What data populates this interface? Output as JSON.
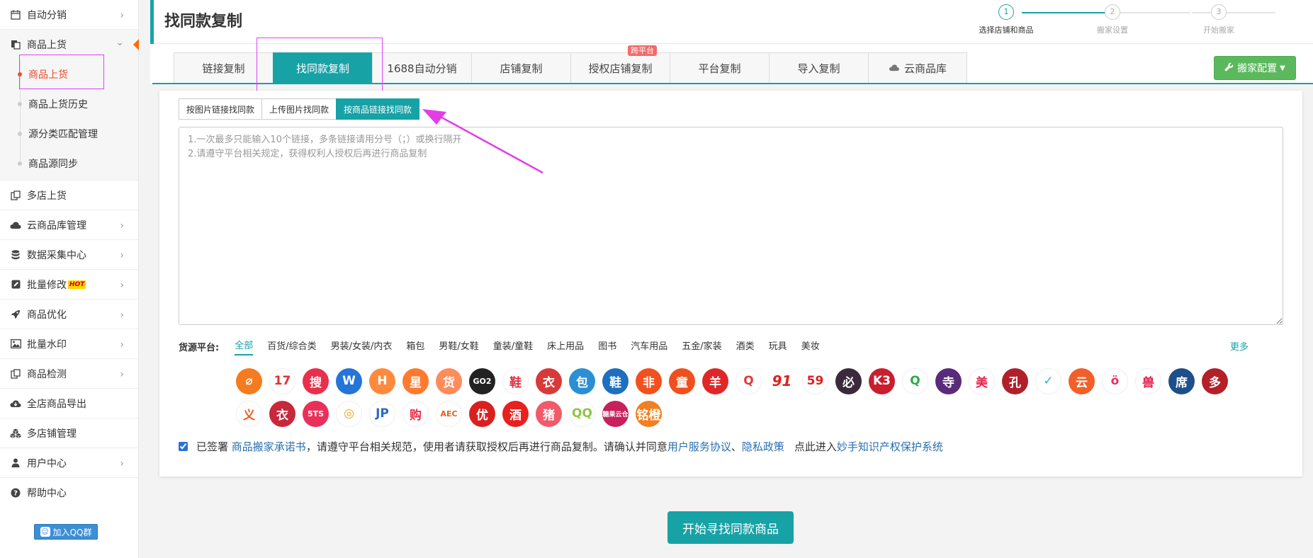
{
  "sidebar": {
    "items": [
      {
        "label": "自动分销",
        "icon": "calendar-icon",
        "chevron": "›"
      },
      {
        "label": "商品上货",
        "icon": "copy-icon",
        "chevron": "⌄"
      },
      {
        "label": "多店上货",
        "icon": "copy-multi-icon"
      },
      {
        "label": "云商品库管理",
        "icon": "cloud-icon",
        "chevron": "›"
      },
      {
        "label": "数据采集中心",
        "icon": "database-icon",
        "chevron": "›"
      },
      {
        "label": "批量修改",
        "icon": "edit-icon",
        "chevron": "›",
        "badge": "HOT"
      },
      {
        "label": "商品优化",
        "icon": "rocket-icon",
        "chevron": "›"
      },
      {
        "label": "批量水印",
        "icon": "image-icon",
        "chevron": "›"
      },
      {
        "label": "商品检测",
        "icon": "copy-check-icon",
        "chevron": "›"
      },
      {
        "label": "全店商品导出",
        "icon": "cloud-download-icon"
      },
      {
        "label": "多店铺管理",
        "icon": "cubes-icon"
      },
      {
        "label": "用户中心",
        "icon": "user-icon",
        "chevron": "›"
      },
      {
        "label": "帮助中心",
        "icon": "question-icon"
      }
    ],
    "sub_items": [
      "商品上货",
      "商品上货历史",
      "源分类匹配管理",
      "商品源同步"
    ],
    "qq_button": "加入QQ群"
  },
  "header": {
    "title": "找同款复制",
    "steps": [
      {
        "num": "1",
        "label": "选择店铺和商品"
      },
      {
        "num": "2",
        "label": "搬家设置"
      },
      {
        "num": "3",
        "label": "开始搬家"
      }
    ]
  },
  "tabs": [
    {
      "label": "链接复制"
    },
    {
      "label": "找同款复制"
    },
    {
      "label": "1688自动分销"
    },
    {
      "label": "店铺复制"
    },
    {
      "label": "授权店铺复制",
      "badge": "跨平台"
    },
    {
      "label": "平台复制"
    },
    {
      "label": "导入复制"
    },
    {
      "label": "云商品库"
    }
  ],
  "config_button": "搬家配置",
  "subtabs": [
    "按图片链接找同款",
    "上传图片找同款",
    "按商品链接找同款"
  ],
  "textarea": {
    "placeholder": "1.一次最多只能输入10个链接，多条链接请用分号（；）或换行隔开\n2.请遵守平台相关规定，获得权利人授权后再进行商品复制"
  },
  "platforms": {
    "label": "货源平台:",
    "categories": [
      "全部",
      "百货/综合类",
      "男装/女装/内衣",
      "箱包",
      "男鞋/女鞋",
      "童装/童鞋",
      "床上用品",
      "图书",
      "汽车用品",
      "五金/家装",
      "酒类",
      "玩具",
      "美妆"
    ],
    "more": "更多",
    "logos_row1": [
      {
        "text": "⌀",
        "color": "#f47b20"
      },
      {
        "text": "17",
        "color": "#ffffff",
        "fg": "#e03030"
      },
      {
        "text": "搜",
        "color": "#e8304c"
      },
      {
        "text": "W",
        "color": "#2574d8"
      },
      {
        "text": "H",
        "color": "#ff8a3d"
      },
      {
        "text": "星",
        "color": "#ff7a2f"
      },
      {
        "text": "货",
        "color": "#ff8c5a"
      },
      {
        "text": "GO2",
        "color": "#222222"
      },
      {
        "text": "鞋",
        "color": "#ffffff",
        "fg": "#e03040"
      },
      {
        "text": "衣",
        "color": "#d83a3a"
      },
      {
        "text": "包",
        "color": "#2b8fd4"
      },
      {
        "text": "鞋",
        "color": "#1e6fc0"
      },
      {
        "text": "非",
        "color": "#f2501e"
      },
      {
        "text": "童",
        "color": "#f0501e"
      },
      {
        "text": "羊",
        "color": "#e02626"
      },
      {
        "text": "Q",
        "color": "#ffffff",
        "fg": "#e03b3b"
      },
      {
        "text": "91",
        "color": "plain"
      },
      {
        "text": "59",
        "color": "#ffffff",
        "fg": "#e02020"
      },
      {
        "text": "必",
        "color": "#3a2a3a"
      },
      {
        "text": "K3",
        "color": "#c81e2e"
      },
      {
        "text": "Q",
        "color": "#ffffff",
        "fg": "#2fa84a"
      },
      {
        "text": "寺",
        "color": "#5a2b7a"
      },
      {
        "text": "美",
        "color": "#ffffff",
        "fg": "#e8254e"
      },
      {
        "text": "孔",
        "color": "#b0202a"
      },
      {
        "text": "✓",
        "color": "#ffffff",
        "fg": "#33b5b5"
      },
      {
        "text": "云",
        "color": "#f0602a"
      },
      {
        "text": "ö",
        "color": "#ffffff",
        "fg": "#e83060"
      },
      {
        "text": "兽",
        "color": "#ffffff",
        "fg": "#e0204a"
      },
      {
        "text": "席",
        "color": "#1e4f8a"
      },
      {
        "text": "多",
        "color": "#b3202a"
      }
    ],
    "logos_row2": [
      {
        "text": "义",
        "color": "#ffffff",
        "fg": "#f05a20"
      },
      {
        "text": "衣",
        "color": "#c8283c"
      },
      {
        "text": "5TS",
        "color": "#e8305a"
      },
      {
        "text": "◎",
        "color": "#ffffff",
        "fg": "#f5a020"
      },
      {
        "text": "JP",
        "color": "#ffffff",
        "fg": "#2a68c8"
      },
      {
        "text": "购",
        "color": "#ffffff",
        "fg": "#e8304c"
      },
      {
        "text": "AEC",
        "color": "#ffffff",
        "fg": "#e06020"
      },
      {
        "text": "优",
        "color": "#d82020"
      },
      {
        "text": "酒",
        "color": "#e82020"
      },
      {
        "text": "猪",
        "color": "#f05a6a"
      },
      {
        "text": "QQ",
        "color": "#ffffff",
        "fg": "#8cc63f"
      },
      {
        "text": "糖果云仓",
        "color": "#c8205a"
      },
      {
        "text": "铭橙",
        "color": "#f08020"
      }
    ]
  },
  "agreement": {
    "prefix": "已签署",
    "link1": "商品搬家承诺书",
    "middle": "，请遵守平台相关规范，使用者请获取授权后再进行商品复制。请确认并同意",
    "link2": "用户服务协议",
    "sep": "、",
    "link3": "隐私政策",
    "enter": "点此进入",
    "link4": "妙手知识产权保护系统"
  },
  "start_button": "开始寻找同款商品",
  "colors": {
    "accent": "#17a2a6",
    "highlight": "#e040fb",
    "config": "#5cb85c"
  }
}
